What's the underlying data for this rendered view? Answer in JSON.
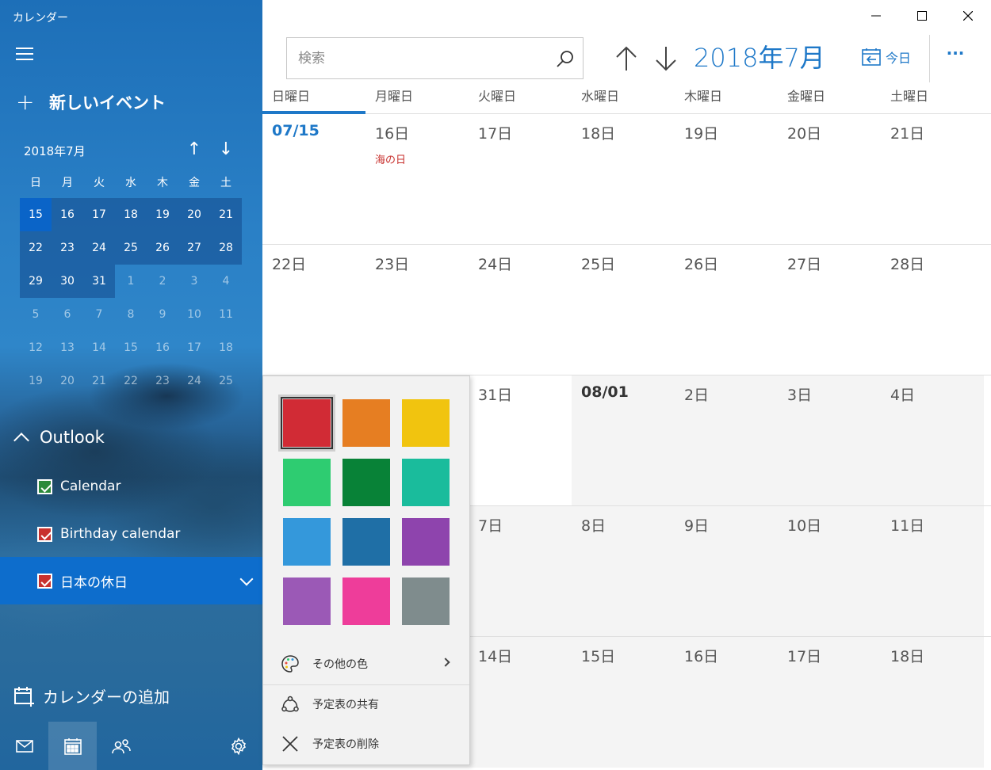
{
  "app": {
    "title": "カレンダー"
  },
  "sidebar": {
    "new_event": "新しいイベント",
    "mini_calendar": {
      "month": "2018年7月",
      "weekdays": [
        "日",
        "月",
        "火",
        "水",
        "木",
        "金",
        "土"
      ],
      "weeks": [
        [
          "15",
          "16",
          "17",
          "18",
          "19",
          "20",
          "21"
        ],
        [
          "22",
          "23",
          "24",
          "25",
          "26",
          "27",
          "28"
        ],
        [
          "29",
          "30",
          "31",
          "1",
          "2",
          "3",
          "4"
        ],
        [
          "5",
          "6",
          "7",
          "8",
          "9",
          "10",
          "11"
        ],
        [
          "12",
          "13",
          "14",
          "15",
          "16",
          "17",
          "18"
        ],
        [
          "19",
          "20",
          "21",
          "22",
          "23",
          "24",
          "25"
        ]
      ]
    },
    "account": "Outlook",
    "calendars": [
      {
        "label": "Calendar",
        "check_color": "#2c8a3a"
      },
      {
        "label": "Birthday calendar",
        "check_color": "#c8312e"
      },
      {
        "label": "日本の休日",
        "check_color": "#c8312e"
      }
    ],
    "add_calendar": "カレンダーの追加"
  },
  "toolbar": {
    "search_placeholder": "検索",
    "month_title": "2018年7月",
    "today_label": "今日"
  },
  "calendar": {
    "weekdays": [
      "日曜日",
      "月曜日",
      "火曜日",
      "水曜日",
      "木曜日",
      "金曜日",
      "土曜日"
    ],
    "week1": [
      "07/15",
      "16日",
      "17日",
      "18日",
      "19日",
      "20日",
      "21日"
    ],
    "holiday": "海の日",
    "week2": [
      "22日",
      "23日",
      "24日",
      "25日",
      "26日",
      "27日",
      "28日"
    ],
    "week3": [
      "",
      "",
      "31日",
      "08/01",
      "2日",
      "3日",
      "4日"
    ],
    "week4": [
      "",
      "",
      "7日",
      "8日",
      "9日",
      "10日",
      "11日"
    ],
    "week5": [
      "",
      "",
      "14日",
      "15日",
      "16日",
      "17日",
      "18日"
    ]
  },
  "color_picker": {
    "swatches": [
      "#d12b35",
      "#e67e22",
      "#f1c40f",
      "#2ecc71",
      "#088237",
      "#1abc9c",
      "#3498db",
      "#1f6fa6",
      "#8e44ad",
      "#9b59b6",
      "#ee3d9a",
      "#7f8c8d"
    ],
    "more_colors": "その他の色",
    "share": "予定表の共有",
    "delete": "予定表の削除"
  },
  "colors": {
    "accent": "#1e78c8",
    "holiday": "#c8312e"
  }
}
